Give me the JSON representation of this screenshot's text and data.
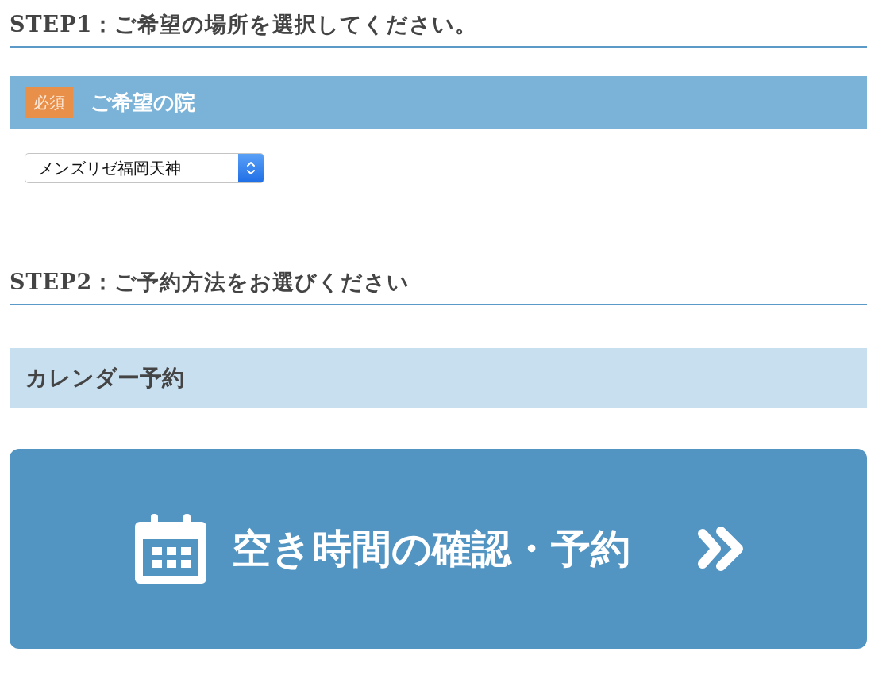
{
  "step1": {
    "heading": "STEP1：ご希望の場所を選択してください。",
    "field": {
      "badge": "必須",
      "label": "ご希望の院",
      "value": "メンズリゼ福岡天神"
    }
  },
  "step2": {
    "heading": "STEP2：ご予約方法をお選びください",
    "method": "カレンダー予約",
    "button": "空き時間の確認・予約"
  }
}
